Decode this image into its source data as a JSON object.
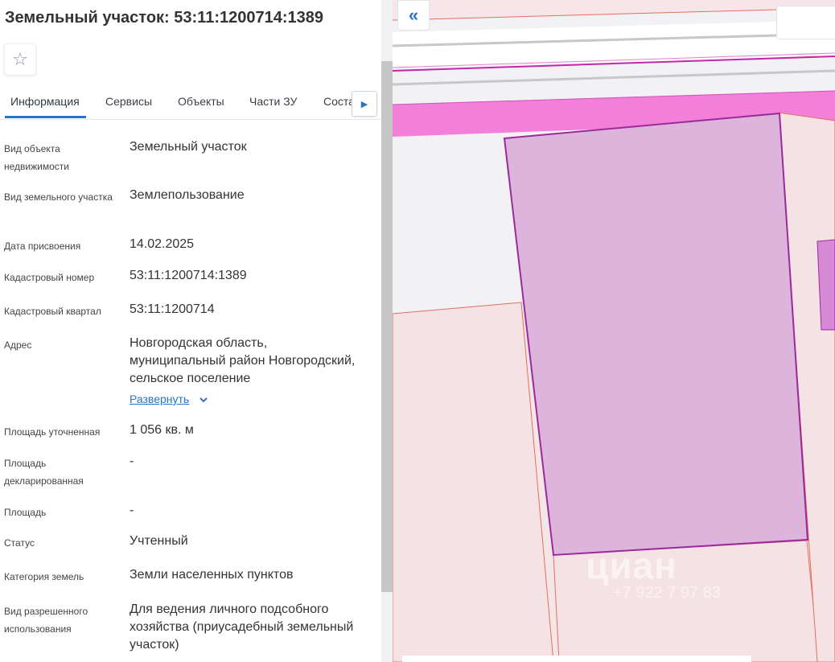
{
  "header": {
    "title": "Земельный участок: 53:11:1200714:1389"
  },
  "tabs": [
    {
      "label": "Информация",
      "active": true
    },
    {
      "label": "Сервисы"
    },
    {
      "label": "Объекты"
    },
    {
      "label": "Части ЗУ"
    },
    {
      "label": "Соста"
    }
  ],
  "info": [
    {
      "label": "Вид объекта недвижимости",
      "value": "Земельный участок"
    },
    {
      "label": "Вид земельного участка",
      "value": "Землепользование"
    },
    {
      "label": "Дата присвоения",
      "value": "14.02.2025"
    },
    {
      "label": "Кадастровый номер",
      "value": "53:11:1200714:1389"
    },
    {
      "label": "Кадастровый квартал",
      "value": "53:11:1200714"
    },
    {
      "label": "Адрес",
      "value": "Новгородская область, муниципальный район Новгородский, сельское поселение"
    },
    {
      "label": "Площадь уточненная",
      "value": "1 056 кв. м"
    },
    {
      "label": "Площадь декларированная",
      "value": "-"
    },
    {
      "label": "Площадь",
      "value": "-"
    },
    {
      "label": "Статус",
      "value": "Учтенный"
    },
    {
      "label": "Категория земель",
      "value": "Земли населенных пунктов"
    },
    {
      "label": "Вид разрешенного использования",
      "value": "Для ведения личного подсобного хозяйства (приусадебный земельный участок)"
    }
  ],
  "expand_label": "Развернуть",
  "icons": {
    "favorite": "star-icon",
    "tab_scroll": "caret-right-icon",
    "collapse": "double-chevron-left-icon",
    "expand": "chevron-down-icon"
  },
  "map": {
    "watermark": "циан",
    "watermark_phone": "+7 922 7 97 83"
  },
  "colors": {
    "accent": "#2a73c5",
    "parcel_fill": "#d9a8d6",
    "parcel_stroke": "#9c2a9c",
    "road_strip": "#f27fd8"
  }
}
